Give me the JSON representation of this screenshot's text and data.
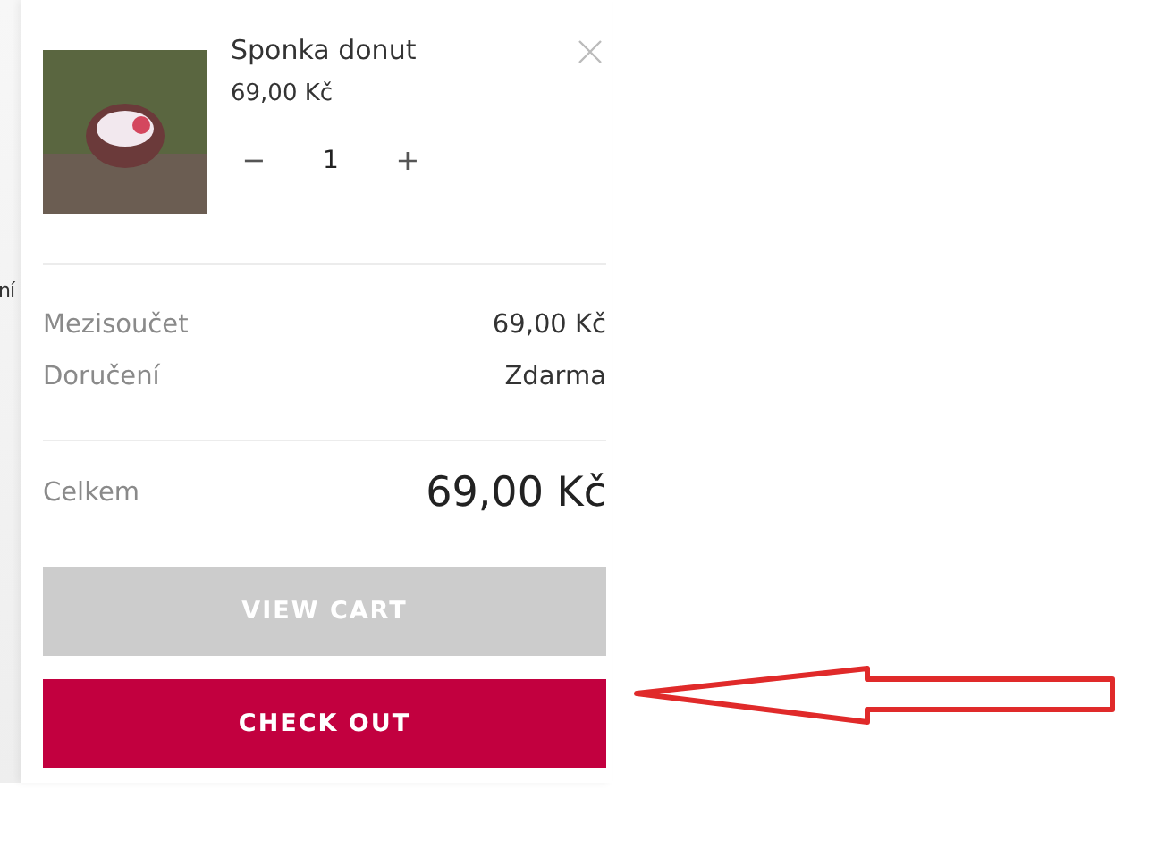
{
  "background": {
    "fragment": "ní"
  },
  "cart": {
    "items": [
      {
        "name": "Sponka donut",
        "price": "69,00 Kč",
        "quantity": "1",
        "minus": "−",
        "plus": "+"
      }
    ],
    "subtotal": {
      "label": "Mezisoučet",
      "value": "69,00 Kč"
    },
    "shipping": {
      "label": "Doručení",
      "value": "Zdarma"
    },
    "total": {
      "label": "Celkem",
      "value": "69,00 Kč"
    },
    "buttons": [
      {
        "label": "VIEW CART",
        "kind": "secondary"
      },
      {
        "label": "CHECK OUT",
        "kind": "primary"
      }
    ]
  }
}
